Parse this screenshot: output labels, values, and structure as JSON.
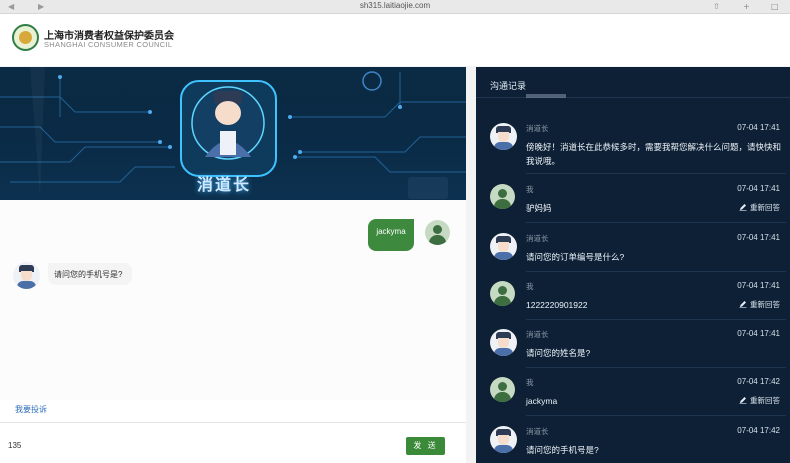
{
  "browser": {
    "url": "sh315.laitiaojie.com"
  },
  "header": {
    "org_name": "上海市消费者权益保护委员会",
    "org_name_en": "SHANGHAI CONSUMER COUNCIL"
  },
  "banner": {
    "title": "消道长"
  },
  "chat": {
    "user_message": "jackyma",
    "bot_message": "请问您的手机号是?"
  },
  "footer": {
    "complaint_link": "我要投诉",
    "input_value": "135",
    "send_label": "发 送"
  },
  "history": {
    "title": "沟通记录",
    "reanswer_label": "重新回答",
    "records": [
      {
        "who": "消道长",
        "role": "bot",
        "time": "07-04 17:41",
        "msg": "傍晚好！消道长在此恭候多时，需要我帮您解决什么问题，请快快和我说哦。"
      },
      {
        "who": "我",
        "role": "user",
        "time": "07-04 17:41",
        "msg": "驴妈妈"
      },
      {
        "who": "消道长",
        "role": "bot",
        "time": "07-04 17:41",
        "msg": "请问您的订单编号是什么?"
      },
      {
        "who": "我",
        "role": "user",
        "time": "07-04 17:41",
        "msg": "1222220901922"
      },
      {
        "who": "消道长",
        "role": "bot",
        "time": "07-04 17:41",
        "msg": "请问您的姓名是?"
      },
      {
        "who": "我",
        "role": "user",
        "time": "07-04 17:42",
        "msg": "jackyma"
      },
      {
        "who": "消道长",
        "role": "bot",
        "time": "07-04 17:42",
        "msg": "请问您的手机号是?"
      }
    ]
  },
  "colors": {
    "accent_green": "#3a8a3a",
    "panel_bg": "#0d2035",
    "link_blue": "#2d6fb8"
  }
}
